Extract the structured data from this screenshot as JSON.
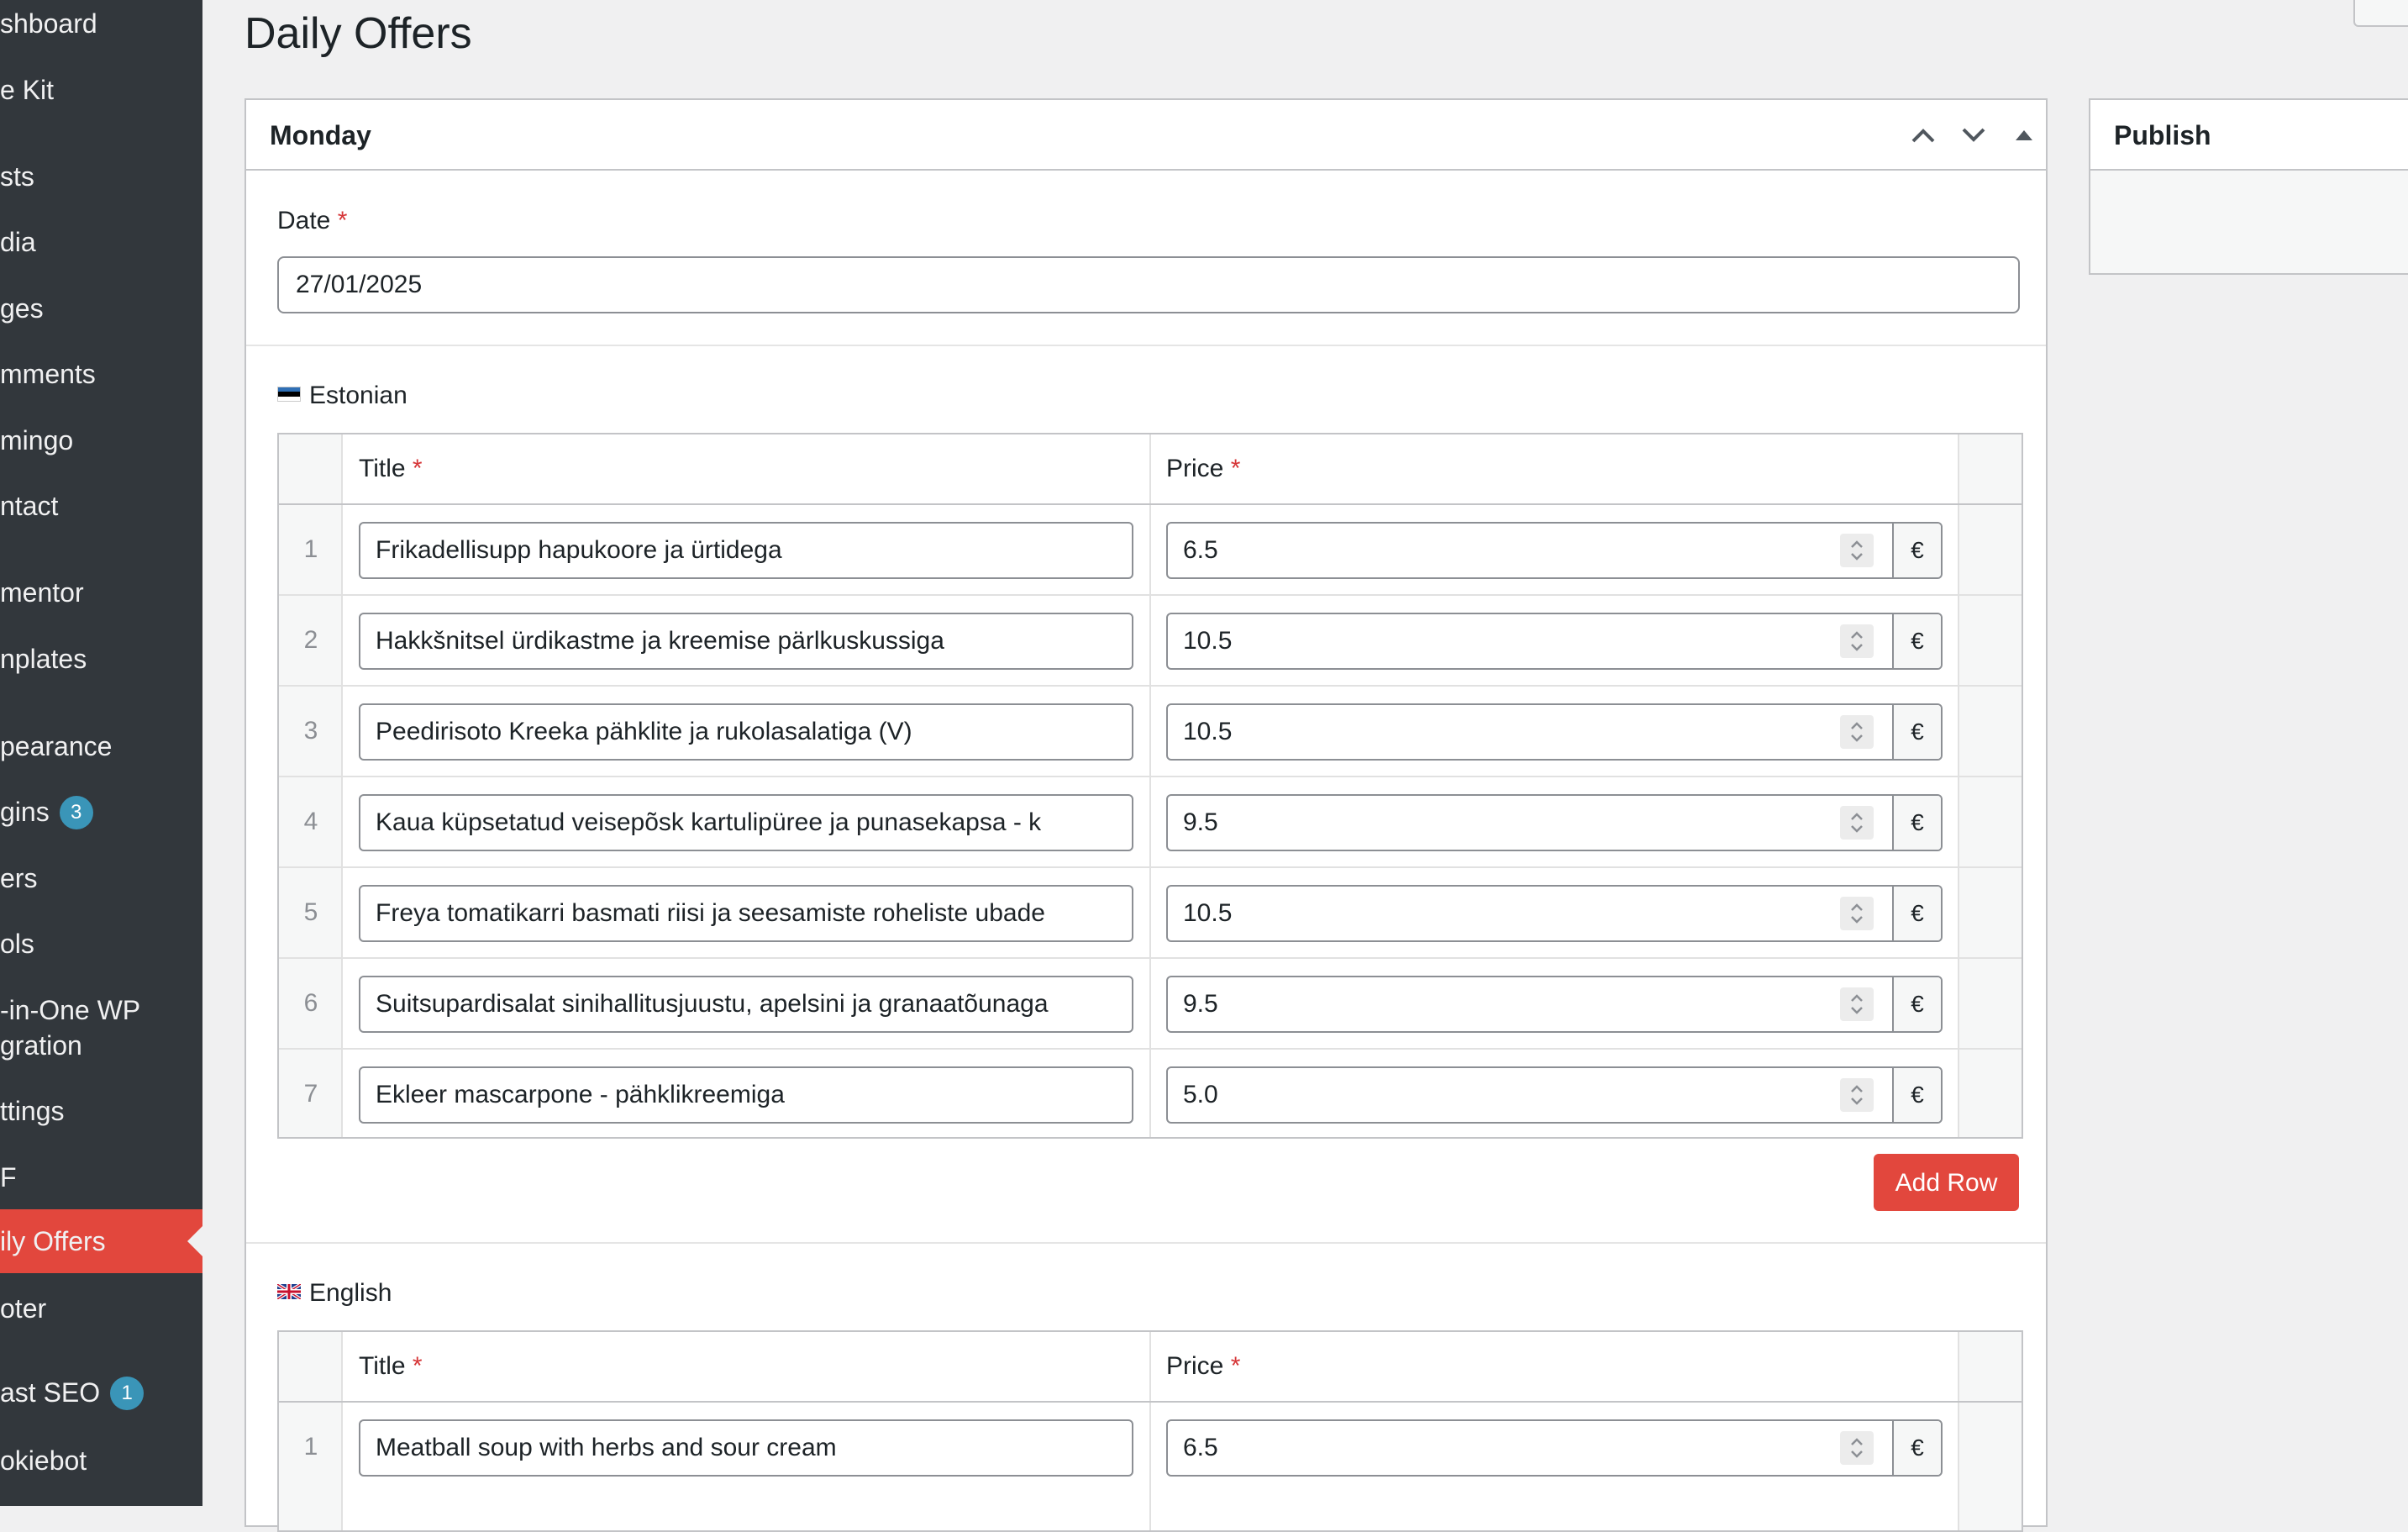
{
  "sidebar": {
    "items": [
      {
        "label": "shboard"
      },
      {
        "label": "e Kit"
      },
      {
        "label": "sts"
      },
      {
        "label": "dia"
      },
      {
        "label": "ges"
      },
      {
        "label": "mments"
      },
      {
        "label": "mingo"
      },
      {
        "label": "ntact"
      },
      {
        "label": "mentor"
      },
      {
        "label": "nplates"
      },
      {
        "label": "pearance"
      },
      {
        "label": "gins",
        "badge": "3"
      },
      {
        "label": "ers"
      },
      {
        "label": "ols"
      },
      {
        "label": "-in-One WP\ngration"
      },
      {
        "label": "ttings"
      },
      {
        "label": "F"
      },
      {
        "label": "ily Offers",
        "active": true
      },
      {
        "label": "oter"
      },
      {
        "label": "ast SEO",
        "badge": "1"
      },
      {
        "label": "okiebot"
      }
    ]
  },
  "page": {
    "title": "Daily Offers"
  },
  "metabox": {
    "title": "Monday",
    "date_label": "Date",
    "required_mark": "*",
    "date_value": "27/01/2025"
  },
  "estonian": {
    "label": "Estonian",
    "col_title": "Title",
    "col_price": "Price",
    "currency": "€",
    "rows": [
      {
        "num": "1",
        "title": "Frikadellisupp hapukoore ja ürtidega",
        "price": "6.5"
      },
      {
        "num": "2",
        "title": "Hakkšnitsel ürdikastme ja kreemise pärlkuskussiga",
        "price": "10.5"
      },
      {
        "num": "3",
        "title": "Peedirisoto Kreeka pähklite ja rukolasalatiga (V)",
        "price": "10.5"
      },
      {
        "num": "4",
        "title": "Kaua küpsetatud veisepõsk kartulipüree ja punasekapsa - k",
        "price": "9.5"
      },
      {
        "num": "5",
        "title": "Freya tomatikarri basmati riisi ja seesamiste roheliste ubade",
        "price": "10.5"
      },
      {
        "num": "6",
        "title": "Suitsupardisalat sinihallitusjuustu, apelsini ja granaatõunaga",
        "price": "9.5"
      },
      {
        "num": "7",
        "title": "Ekleer mascarpone - pähklikreemiga",
        "price": "5.0"
      }
    ],
    "add_row": "Add Row"
  },
  "english": {
    "label": "English",
    "col_title": "Title",
    "col_price": "Price",
    "currency": "€",
    "rows": [
      {
        "num": "1",
        "title": "Meatball soup with herbs and sour cream",
        "price": "6.5"
      }
    ]
  },
  "publish": {
    "title": "Publish"
  },
  "colors": {
    "accent_red": "#e2473d",
    "sidebar_bg": "#32373c",
    "badge_blue": "#3a95b8",
    "required_red": "#d63638"
  }
}
